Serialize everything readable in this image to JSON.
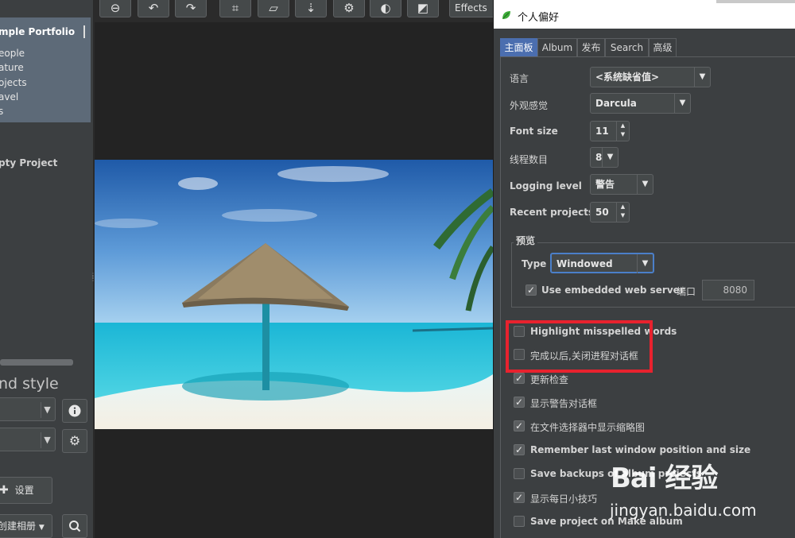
{
  "sidebar": {
    "portfolio_title": "mple Portfolio",
    "items": [
      {
        "label": "eople"
      },
      {
        "label": "ature"
      },
      {
        "label": "ojects"
      },
      {
        "label": "avel"
      },
      {
        "label": "s"
      }
    ],
    "second_project": "pty Project",
    "section_title": "nd style",
    "settings_button": "设置",
    "create_album_button": "创建相册",
    "icons": {
      "info": "info-icon",
      "gear": "gear-icon",
      "search": "search-icon",
      "settings": "puzzle-icon"
    }
  },
  "toolbar": {
    "effects_label": "Effects",
    "buttons": [
      "minus-icon",
      "rotate-left-icon",
      "rotate-right-icon",
      "crop-icon",
      "straighten-icon",
      "flip-icon",
      "gear-icon",
      "contrast-icon",
      "exposure-icon"
    ]
  },
  "dialog": {
    "title": "个人偏好",
    "tabs": [
      {
        "label": "主面板",
        "active": true
      },
      {
        "label": "Album",
        "active": false
      },
      {
        "label": "发布",
        "active": false
      },
      {
        "label": "Search",
        "active": false
      },
      {
        "label": "高级",
        "active": false
      }
    ],
    "fields": {
      "language": {
        "label": "语言",
        "value": "<系统缺省值>"
      },
      "look_and_feel": {
        "label": "外观感觉",
        "value": "Darcula"
      },
      "font_size": {
        "label": "Font size",
        "value": "11"
      },
      "threads": {
        "label": "线程数目",
        "value": "8"
      },
      "logging_level": {
        "label": "Logging level",
        "value": "警告"
      },
      "recent_projects": {
        "label": "Recent projects",
        "value": "50"
      }
    },
    "preview_group": {
      "title": "预览",
      "type_label": "Type",
      "type_value": "Windowed",
      "embedded_server_label": "Use embedded web server",
      "embedded_server_checked": true,
      "port_label": "端口",
      "port_value": "8080"
    },
    "checkboxes": [
      {
        "label": "Highlight misspelled words",
        "checked": false
      },
      {
        "label": "完成以后,关闭进程对话框",
        "checked": false
      },
      {
        "label": "更新检查",
        "checked": true
      },
      {
        "label": "显示警告对话框",
        "checked": true
      },
      {
        "label": "在文件选择器中显示缩略图",
        "checked": true
      },
      {
        "label": "Remember last window position and size",
        "checked": true
      },
      {
        "label": "Save backups of album projects",
        "checked": false
      },
      {
        "label": "显示每日小技巧",
        "checked": true
      },
      {
        "label": "Save project on Make album",
        "checked": false
      }
    ],
    "highlight_color": "#e8222e"
  },
  "watermark": {
    "logo": "Bai 经验",
    "site": "jingyan.baidu.com"
  }
}
